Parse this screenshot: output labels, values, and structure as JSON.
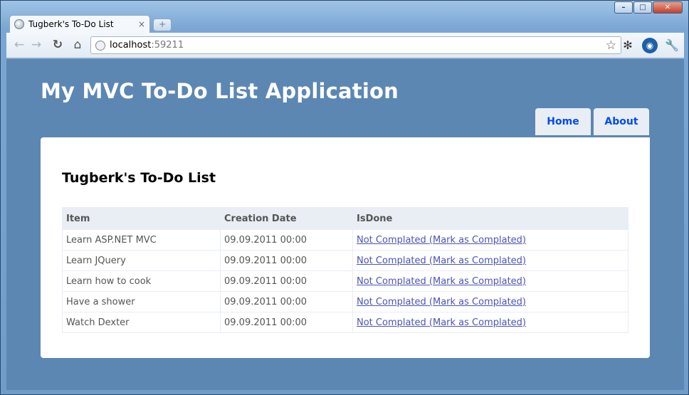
{
  "browser": {
    "tab_title": "Tugberk's To-Do List",
    "tab_close": "×",
    "new_tab": "+",
    "address_host": "localhost",
    "address_port": ":59211",
    "window_buttons": [
      "–",
      "□",
      "✕"
    ]
  },
  "site": {
    "title": "My MVC To-Do List Application",
    "menu": [
      {
        "label": "Home"
      },
      {
        "label": "About"
      }
    ]
  },
  "todo": {
    "heading": "Tugberk's To-Do List",
    "columns": [
      "Item",
      "Creation Date",
      "IsDone"
    ],
    "rows": [
      {
        "item": "Learn ASP.NET MVC",
        "date": "09.09.2011 00:00",
        "status": "Not Complated (Mark as Complated)"
      },
      {
        "item": "Learn JQuery",
        "date": "09.09.2011 00:00",
        "status": "Not Complated (Mark as Complated)"
      },
      {
        "item": "Learn how to cook",
        "date": "09.09.2011 00:00",
        "status": "Not Complated (Mark as Complated)"
      },
      {
        "item": "Have a shower",
        "date": "09.09.2011 00:00",
        "status": "Not Complated (Mark as Complated)"
      },
      {
        "item": "Watch Dexter",
        "date": "09.09.2011 00:00",
        "status": "Not Complated (Mark as Complated)"
      }
    ]
  },
  "colors": {
    "page_background": "#5c87b2",
    "menu_tab_background": "#e8eef4",
    "menu_link": "#034af3",
    "table_link": "#4b54b5"
  },
  "icons": {
    "back": "back-arrow-icon",
    "forward": "forward-arrow-icon",
    "reload": "reload-icon",
    "home": "home-icon",
    "bookmark": "star-icon",
    "extension1": "bug-icon",
    "extension2": "eye-icon",
    "settings": "wrench-icon"
  }
}
